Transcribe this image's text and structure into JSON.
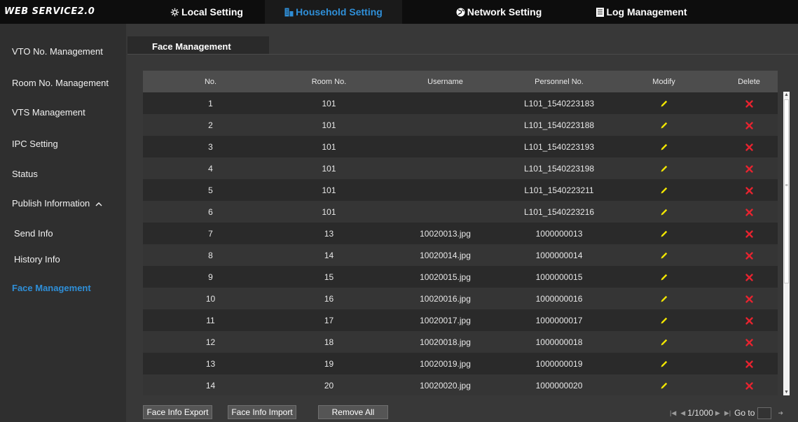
{
  "app": {
    "brand": "WEB SERVICE2.0"
  },
  "nav": {
    "local": "Local Setting",
    "household": "Household Setting",
    "network": "Network Setting",
    "log": "Log Management"
  },
  "sidebar": {
    "vto": "VTO No. Management",
    "room": "Room No. Management",
    "vts": "VTS Management",
    "ipc": "IPC Setting",
    "status": "Status",
    "publish": "Publish Information",
    "send": "Send Info",
    "history": "History Info",
    "face": "Face Management"
  },
  "page": {
    "tab": "Face Management"
  },
  "table": {
    "headers": {
      "no": "No.",
      "room": "Room No.",
      "user": "Username",
      "pers": "Personnel No.",
      "modify": "Modify",
      "delete": "Delete"
    },
    "rows": [
      {
        "no": "1",
        "room": "101",
        "user": "",
        "pers": "L101_1540223183"
      },
      {
        "no": "2",
        "room": "101",
        "user": "",
        "pers": "L101_1540223188"
      },
      {
        "no": "3",
        "room": "101",
        "user": "",
        "pers": "L101_1540223193"
      },
      {
        "no": "4",
        "room": "101",
        "user": "",
        "pers": "L101_1540223198"
      },
      {
        "no": "5",
        "room": "101",
        "user": "",
        "pers": "L101_1540223211"
      },
      {
        "no": "6",
        "room": "101",
        "user": "",
        "pers": "L101_1540223216"
      },
      {
        "no": "7",
        "room": "13",
        "user": "10020013.jpg",
        "pers": "1000000013"
      },
      {
        "no": "8",
        "room": "14",
        "user": "10020014.jpg",
        "pers": "1000000014"
      },
      {
        "no": "9",
        "room": "15",
        "user": "10020015.jpg",
        "pers": "1000000015"
      },
      {
        "no": "10",
        "room": "16",
        "user": "10020016.jpg",
        "pers": "1000000016"
      },
      {
        "no": "11",
        "room": "17",
        "user": "10020017.jpg",
        "pers": "1000000017"
      },
      {
        "no": "12",
        "room": "18",
        "user": "10020018.jpg",
        "pers": "1000000018"
      },
      {
        "no": "13",
        "room": "19",
        "user": "10020019.jpg",
        "pers": "1000000019"
      },
      {
        "no": "14",
        "room": "20",
        "user": "10020020.jpg",
        "pers": "1000000020"
      }
    ]
  },
  "buttons": {
    "export": "Face Info Export",
    "import": "Face Info Import",
    "remove": "Remove All"
  },
  "pager": {
    "page": "1/1000",
    "goto": "Go to"
  },
  "colors": {
    "accent": "#2f8fd8",
    "edit": "#f2e600",
    "delete": "#e8232f"
  },
  "icons": {
    "local": "gear-icon",
    "household": "building-icon",
    "network": "globe-icon",
    "log": "log-icon",
    "modify": "pencil-icon",
    "delete": "x-icon"
  }
}
